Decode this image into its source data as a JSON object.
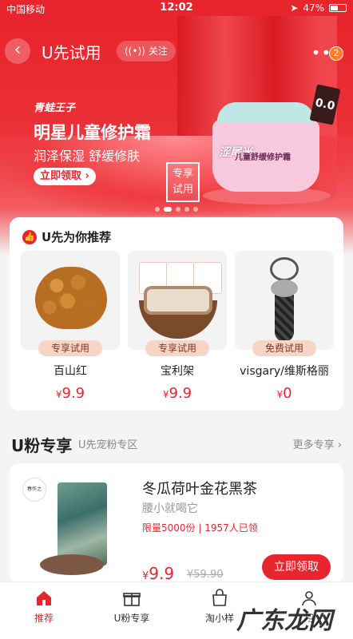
{
  "status_bar": {
    "carrier": "中国移动",
    "time": "12:02",
    "battery": "47%"
  },
  "nav": {
    "title": "U先试用",
    "follow_label": "关注",
    "notification_count": "2"
  },
  "banner": {
    "brand": "青蛙王子",
    "headline": "明星儿童修护霜",
    "subline": "润泽保湿 舒缓修肤",
    "cta": "立即领取",
    "trial_sign": [
      "专享",
      "试用"
    ],
    "jar_logo": "涩尾米",
    "jar_label": "儿童舒缓修护霜",
    "tag": "0.0",
    "page_count": 5,
    "active_page": 1
  },
  "recommend": {
    "title": "U先为你推荐",
    "items": [
      {
        "tag": "专享试用",
        "name": "百山红",
        "currency": "¥",
        "price": "9.9"
      },
      {
        "tag": "专享试用",
        "name": "宝利架",
        "currency": "¥",
        "price": "9.9"
      },
      {
        "tag": "免费试用",
        "name": "visgary/维斯格丽",
        "currency": "¥",
        "price": "0"
      }
    ]
  },
  "u_fan": {
    "title": "U粉专享",
    "subtitle": "U先宠粉专区",
    "more": "更多专享 ›",
    "product": {
      "logo_text": "春作之",
      "name": "冬瓜荷叶金花黑茶",
      "desc": "腰小就喝它",
      "stock": "限量5000份 | 1957人已领",
      "currency": "¥",
      "price": "9.9",
      "original_price": "¥59.90",
      "cta": "立即领取"
    }
  },
  "tabbar": {
    "tabs": [
      {
        "label": "推荐",
        "icon": "home-icon",
        "active": true
      },
      {
        "label": "U粉专享",
        "icon": "gift-icon",
        "active": false
      },
      {
        "label": "淘小样",
        "icon": "bag-icon",
        "active": false
      },
      {
        "label": "用",
        "icon": "user-icon",
        "active": false
      }
    ]
  },
  "watermark": "广东龙网",
  "colors": {
    "accent": "#e8242c",
    "tag_bg": "#f6d4c6"
  }
}
